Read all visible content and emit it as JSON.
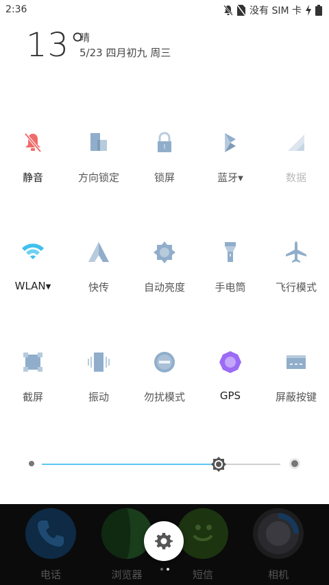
{
  "status_bar": {
    "time": "2:36",
    "network_text": "没有 SIM 卡"
  },
  "weather": {
    "temperature": "13°",
    "condition": "晴",
    "date": "5/23 四月初九 周三"
  },
  "tiles": [
    {
      "label": "静音",
      "icon": "bell-off-icon",
      "state": "active"
    },
    {
      "label": "方向锁定",
      "icon": "rotation-lock-icon",
      "state": "off"
    },
    {
      "label": "锁屏",
      "icon": "lock-icon",
      "state": "off"
    },
    {
      "label": "蓝牙",
      "icon": "bluetooth-icon",
      "state": "off"
    },
    {
      "label": "数据",
      "icon": "signal-icon",
      "state": "disabled"
    },
    {
      "label": "WLAN",
      "icon": "wifi-icon",
      "state": "active"
    },
    {
      "label": "快传",
      "icon": "share-icon",
      "state": "off"
    },
    {
      "label": "自动亮度",
      "icon": "brightness-icon",
      "state": "off"
    },
    {
      "label": "手电筒",
      "icon": "flashlight-icon",
      "state": "off"
    },
    {
      "label": "飞行模式",
      "icon": "airplane-icon",
      "state": "off"
    },
    {
      "label": "截屏",
      "icon": "screenshot-icon",
      "state": "off"
    },
    {
      "label": "振动",
      "icon": "vibrate-icon",
      "state": "off"
    },
    {
      "label": "勿扰模式",
      "icon": "do-not-disturb-icon",
      "state": "off"
    },
    {
      "label": "GPS",
      "icon": "gps-icon",
      "state": "active"
    },
    {
      "label": "屏蔽按键",
      "icon": "keyboard-icon",
      "state": "off"
    }
  ],
  "brightness": {
    "level": 0.74,
    "accent": "#5cc7f2"
  },
  "dock": {
    "apps": [
      {
        "label": "电话",
        "icon": "phone-icon"
      },
      {
        "label": "浏览器",
        "icon": "browser-icon"
      },
      {
        "label": "短信",
        "icon": "messages-icon"
      },
      {
        "label": "相机",
        "icon": "camera-icon"
      }
    ]
  },
  "settings_button": {
    "icon": "gear-icon"
  },
  "colors": {
    "active_red": "#f06b6b",
    "tile_blue": "#90aecb",
    "wifi_cyan": "#3fc0ee",
    "gps_purple": "#9b6bf5"
  }
}
